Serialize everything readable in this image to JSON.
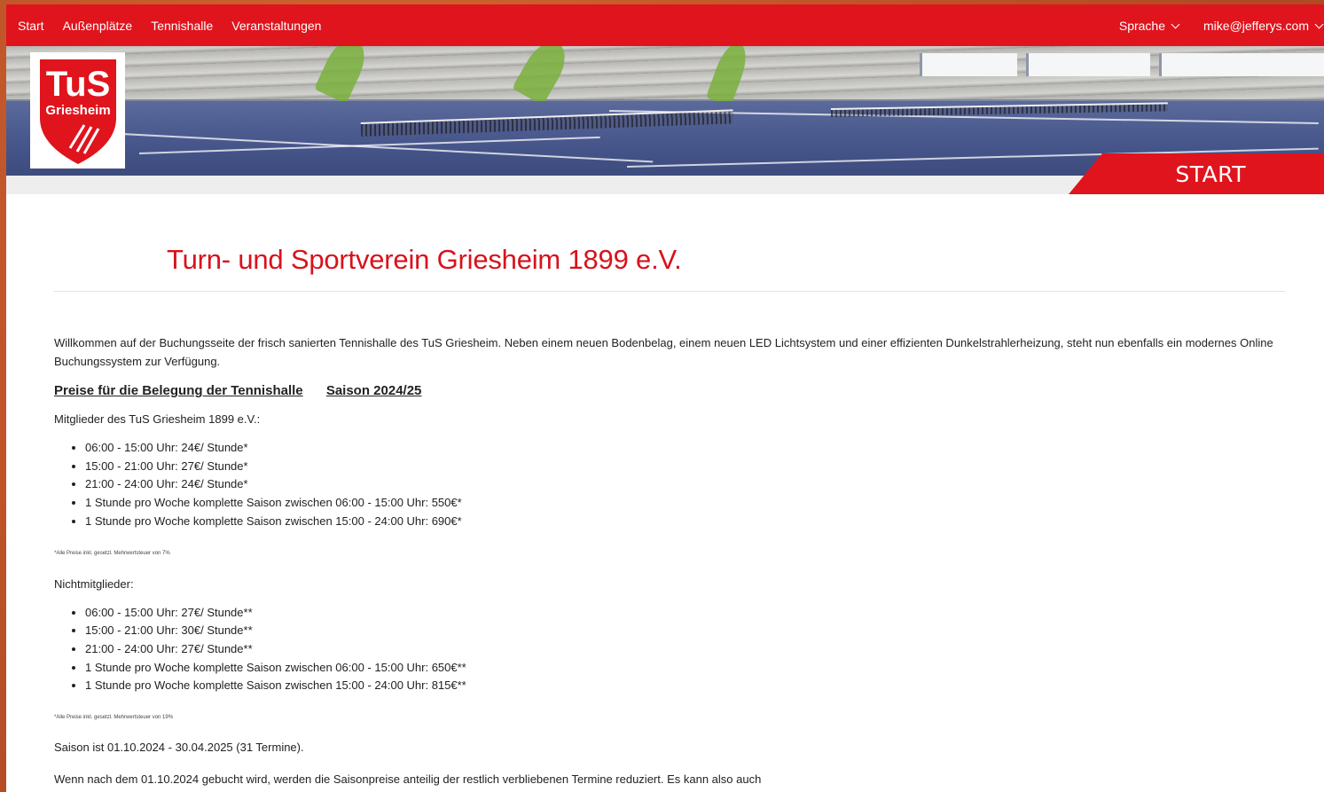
{
  "nav": {
    "links": [
      "Start",
      "Außenplätze",
      "Tennishalle",
      "Veranstaltungen"
    ],
    "language": "Sprache",
    "account": "mike@jefferys.com"
  },
  "logo": {
    "top_text": "TuS",
    "bottom_text": "Griesheim"
  },
  "hero": {
    "badge": "START"
  },
  "main": {
    "title": "Turn- und Sportverein Griesheim 1899 e.V.",
    "intro": "Willkommen auf der Buchungsseite der frisch sanierten Tennishalle des TuS Griesheim. Neben einem neuen Bodenbelag, einem neuen LED Lichtsystem und einer effizienten Dunkelstrahlerheizung,  steht nun ebenfalls ein modernes Online Buchungssystem zur Verfügung.",
    "prices_heading": "Preise für die Belegung der Tennishalle",
    "season_heading": "Saison 2024/25",
    "members_label": "Mitglieder des TuS Griesheim 1899 e.V.:",
    "members_prices": [
      "06:00 - 15:00 Uhr: 24€/ Stunde*",
      "15:00 - 21:00 Uhr: 27€/ Stunde*",
      "21:00 - 24:00 Uhr: 24€/ Stunde*",
      "1 Stunde pro Woche komplette Saison zwischen 06:00 - 15:00 Uhr: 550€*",
      "1 Stunde pro Woche komplette Saison zwischen 15:00 - 24:00 Uhr: 690€*"
    ],
    "members_note": "*Alle Preise inkl. gesetzl. Mehrwertsteuer von 7%",
    "nonmembers_label": "Nichtmitglieder:",
    "nonmembers_prices": [
      "06:00 - 15:00 Uhr: 27€/ Stunde**",
      "15:00 - 21:00 Uhr: 30€/ Stunde**",
      "21:00 - 24:00 Uhr: 27€/ Stunde**",
      "1 Stunde pro Woche komplette Saison zwischen 06:00 - 15:00 Uhr: 650€**",
      "1 Stunde pro Woche komplette Saison zwischen 15:00 - 24:00 Uhr: 815€**"
    ],
    "nonmembers_note": "*Alle Preise inkl. gesetzl. Mehrwertsteuer von 19%",
    "season_text": "Saison ist 01.10.2024 - 30.04.2025 (31 Termine).",
    "booking_note": "Wenn nach dem 01.10.2024 gebucht wird, werden die Saisonpreise anteilig der restlich verbliebenen Termine reduziert. Es kann also auch"
  },
  "colors": {
    "brand_red": "#e0141d",
    "title_red": "#d8121c"
  }
}
